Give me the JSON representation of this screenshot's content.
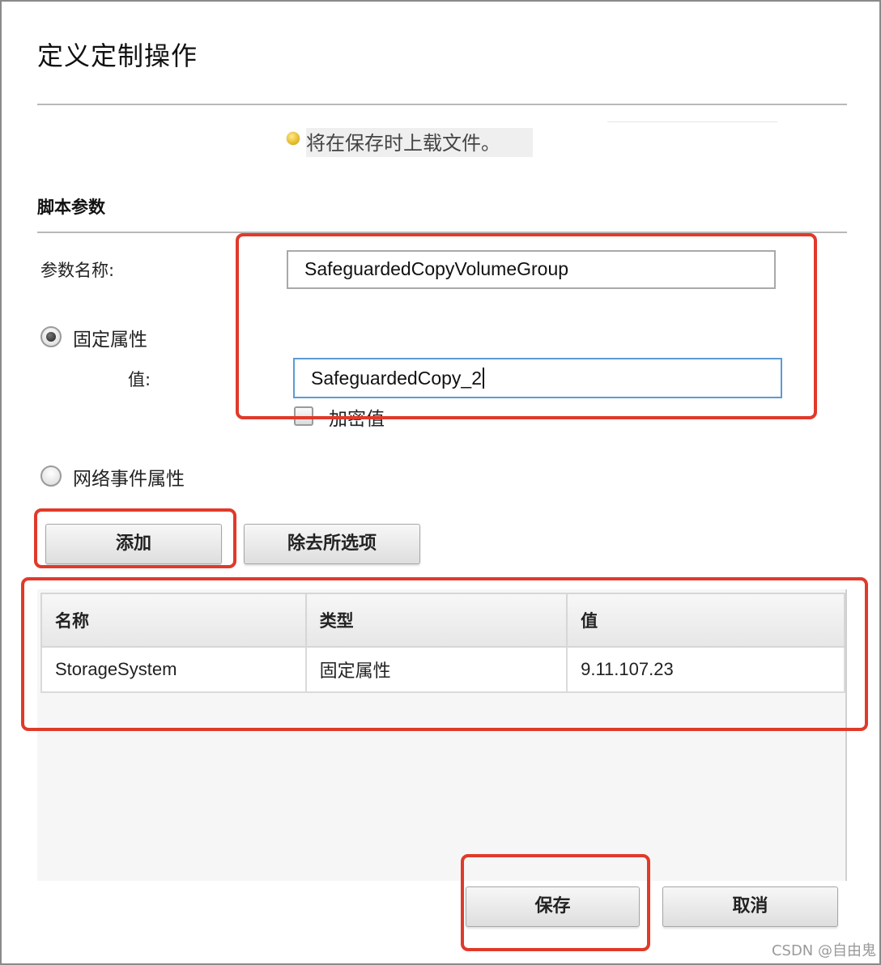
{
  "dialog": {
    "title": "定义定制操作"
  },
  "notice": {
    "icon": "status-dot-icon",
    "text": "将在保存时上载文件。"
  },
  "section": {
    "title": "脚本参数"
  },
  "form": {
    "param_name_label": "参数名称:",
    "param_name_value": "SafeguardedCopyVolumeGroup",
    "radio_fixed_label": "固定属性",
    "radio_fixed_checked": true,
    "value_label": "值:",
    "value_value": "SafeguardedCopy_2",
    "encrypt_label": "加密值",
    "encrypt_checked": false,
    "radio_network_label": "网络事件属性",
    "radio_network_checked": false
  },
  "buttons": {
    "add": "添加",
    "clear": "除去所选项",
    "save": "保存",
    "cancel": "取消"
  },
  "table": {
    "headers": [
      "名称",
      "类型",
      "值"
    ],
    "rows": [
      [
        "StorageSystem",
        "固定属性",
        "9.11.107.23"
      ]
    ]
  },
  "highlight_color": "#e03a2a",
  "watermark": "CSDN @自由鬼"
}
